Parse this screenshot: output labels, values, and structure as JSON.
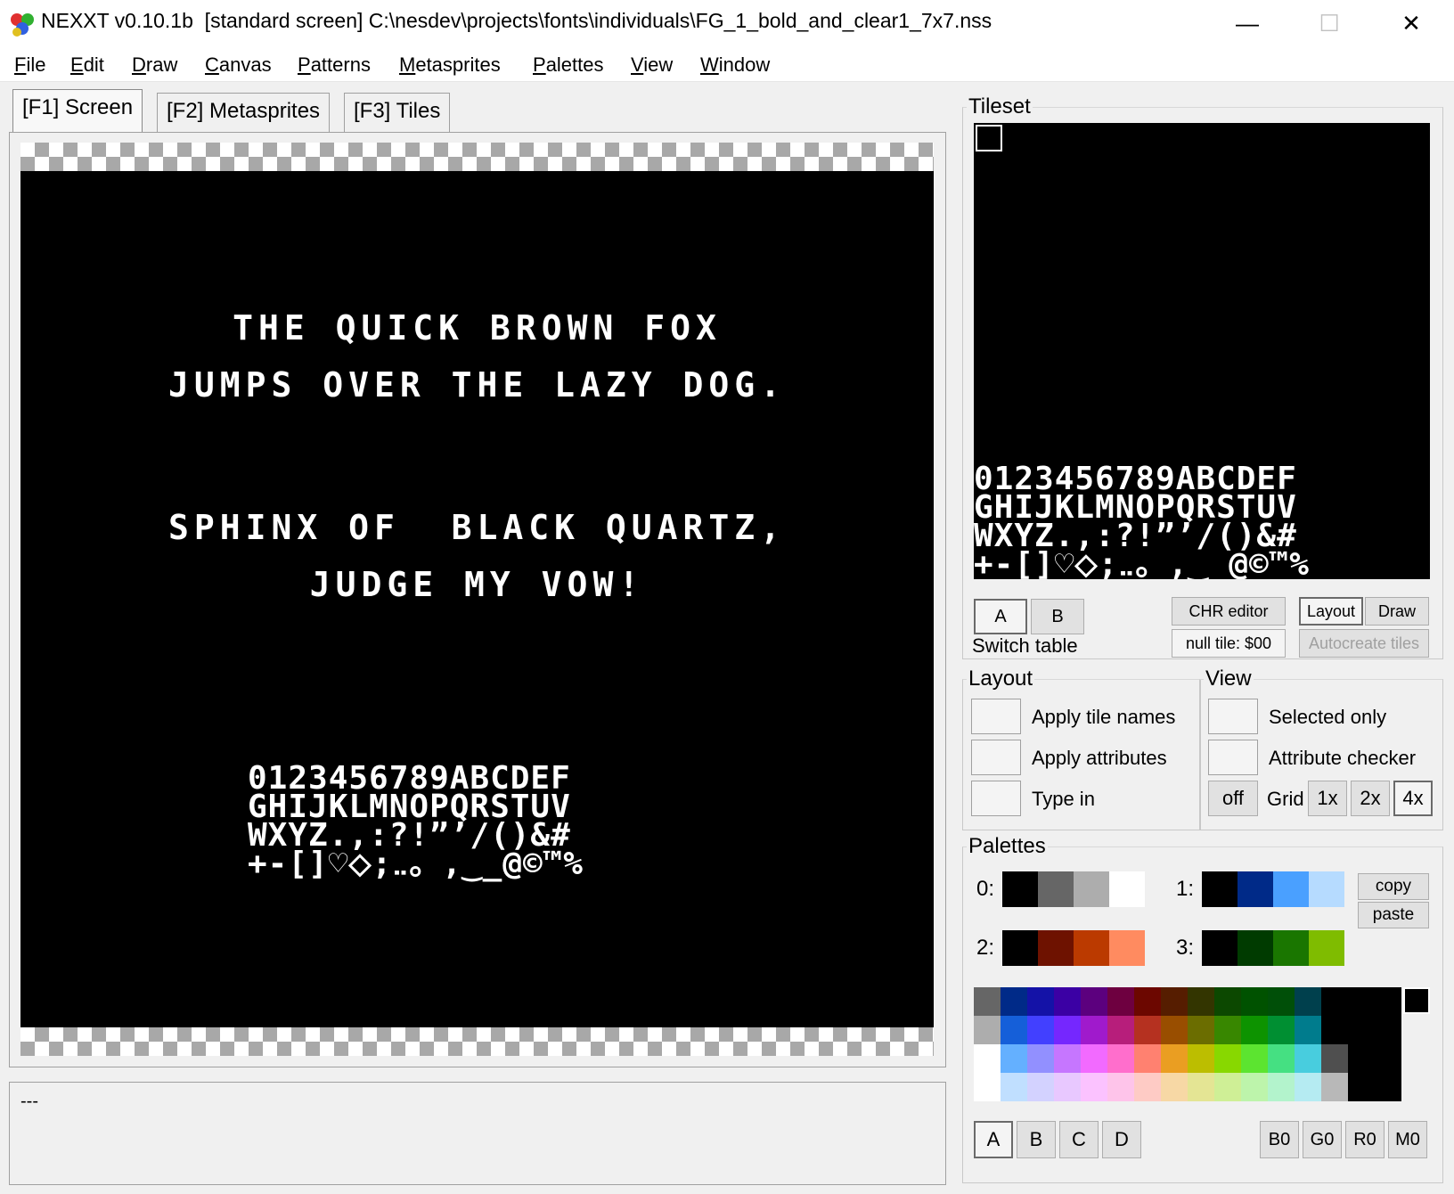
{
  "window": {
    "title": "NEXXT v0.10.1b  [standard screen] C:\\nesdev\\projects\\fonts\\individuals\\FG_1_bold_and_clear1_7x7.nss",
    "minimize": "—",
    "maximize": "☐",
    "close": "✕"
  },
  "menu": [
    {
      "first": "F",
      "rest": "ile"
    },
    {
      "first": "E",
      "rest": "dit"
    },
    {
      "first": "D",
      "rest": "raw"
    },
    {
      "first": "C",
      "rest": "anvas"
    },
    {
      "first": "P",
      "rest": "atterns"
    },
    {
      "first": "M",
      "rest": "etasprites"
    },
    {
      "first": "P",
      "rest": "alettes"
    },
    {
      "first": "V",
      "rest": "iew"
    },
    {
      "first": "W",
      "rest": "indow"
    }
  ],
  "tabs": [
    "[F1] Screen",
    "[F2] Metasprites",
    "[F3] Tiles"
  ],
  "screen": {
    "line1": "THE QUICK BROWN FOX",
    "line2": "JUMPS OVER THE LAZY DOG.",
    "line3": "SPHINX OF  BLACK QUARTZ,",
    "line4": "JUDGE MY VOW!",
    "charset": [
      "0123456789ABCDEF",
      "GHIJKLMNOPQRSTUV",
      "WXYZ.,:?!”’/()&#",
      "+-[]♡⬦;‥。,‿_@©™%"
    ]
  },
  "status": {
    "text": "---"
  },
  "tileset": {
    "label": "Tileset",
    "charset": [
      "0123456789ABCDEF",
      "GHIJKLMNOPQRSTUV",
      "WXYZ.,:?!”’/()&#",
      "+-[]♡⬦;‥。,‿_@©™%"
    ],
    "table_a": "A",
    "table_b": "B",
    "switch_table": "Switch table",
    "chr_editor": "CHR editor",
    "null_tile": "null tile: $00",
    "layout": "Layout",
    "draw": "Draw",
    "autocreate": "Autocreate tiles"
  },
  "layout_group": {
    "label": "Layout",
    "apply_tile_names": "Apply tile names",
    "apply_attributes": "Apply attributes",
    "type_in": "Type in"
  },
  "view_group": {
    "label": "View",
    "selected_only": "Selected only",
    "attribute_checker": "Attribute checker",
    "grid_off": "off",
    "grid": "Grid",
    "g1": "1x",
    "g2": "2x",
    "g4": "4x"
  },
  "palettes": {
    "label": "Palettes",
    "p0": "0:",
    "p1": "1:",
    "p2": "2:",
    "p3": "3:",
    "pal0": [
      "#000000",
      "#666666",
      "#adadad",
      "#ffffff"
    ],
    "pal1": [
      "#000000",
      "#002a88",
      "#4aa0ff",
      "#b6dbff"
    ],
    "pal2": [
      "#000000",
      "#6e1200",
      "#bb3a00",
      "#ff8b60"
    ],
    "pal3": [
      "#000000",
      "#003b00",
      "#1a7600",
      "#7fbc00"
    ],
    "copy": "copy",
    "paste": "paste",
    "nes": [
      "#666666",
      "#002a88",
      "#1412a7",
      "#3b00a4",
      "#5c007e",
      "#6e0040",
      "#6c0700",
      "#561d00",
      "#333500",
      "#0c4800",
      "#005200",
      "#004f08",
      "#00404d",
      "#000000",
      "#000000",
      "#000000",
      "#adadad",
      "#155fd9",
      "#4240ff",
      "#7527fe",
      "#a01acc",
      "#b71e7b",
      "#b53120",
      "#994e00",
      "#6b6d00",
      "#388700",
      "#0d9300",
      "#008f32",
      "#007c8d",
      "#000000",
      "#000000",
      "#000000",
      "#ffffff",
      "#64b0ff",
      "#9290ff",
      "#c676ff",
      "#f26aff",
      "#ff6ecc",
      "#ff8170",
      "#ea9e22",
      "#bcbe00",
      "#88d800",
      "#5ce430",
      "#45e082",
      "#48cdde",
      "#4f4f4f",
      "#000000",
      "#000000",
      "#ffffff",
      "#c0dfff",
      "#d3d2ff",
      "#e8c8ff",
      "#fbc2ff",
      "#fec4ea",
      "#fecbc5",
      "#f7d8a5",
      "#e4e594",
      "#cfef96",
      "#bdf4ab",
      "#b3f3cc",
      "#b5ebf2",
      "#b8b8b8",
      "#000000",
      "#000000"
    ],
    "sub_a": "A",
    "sub_b": "B",
    "sub_c": "C",
    "sub_d": "D",
    "b0": "B0",
    "g0": "G0",
    "r0": "R0",
    "m0": "M0"
  }
}
